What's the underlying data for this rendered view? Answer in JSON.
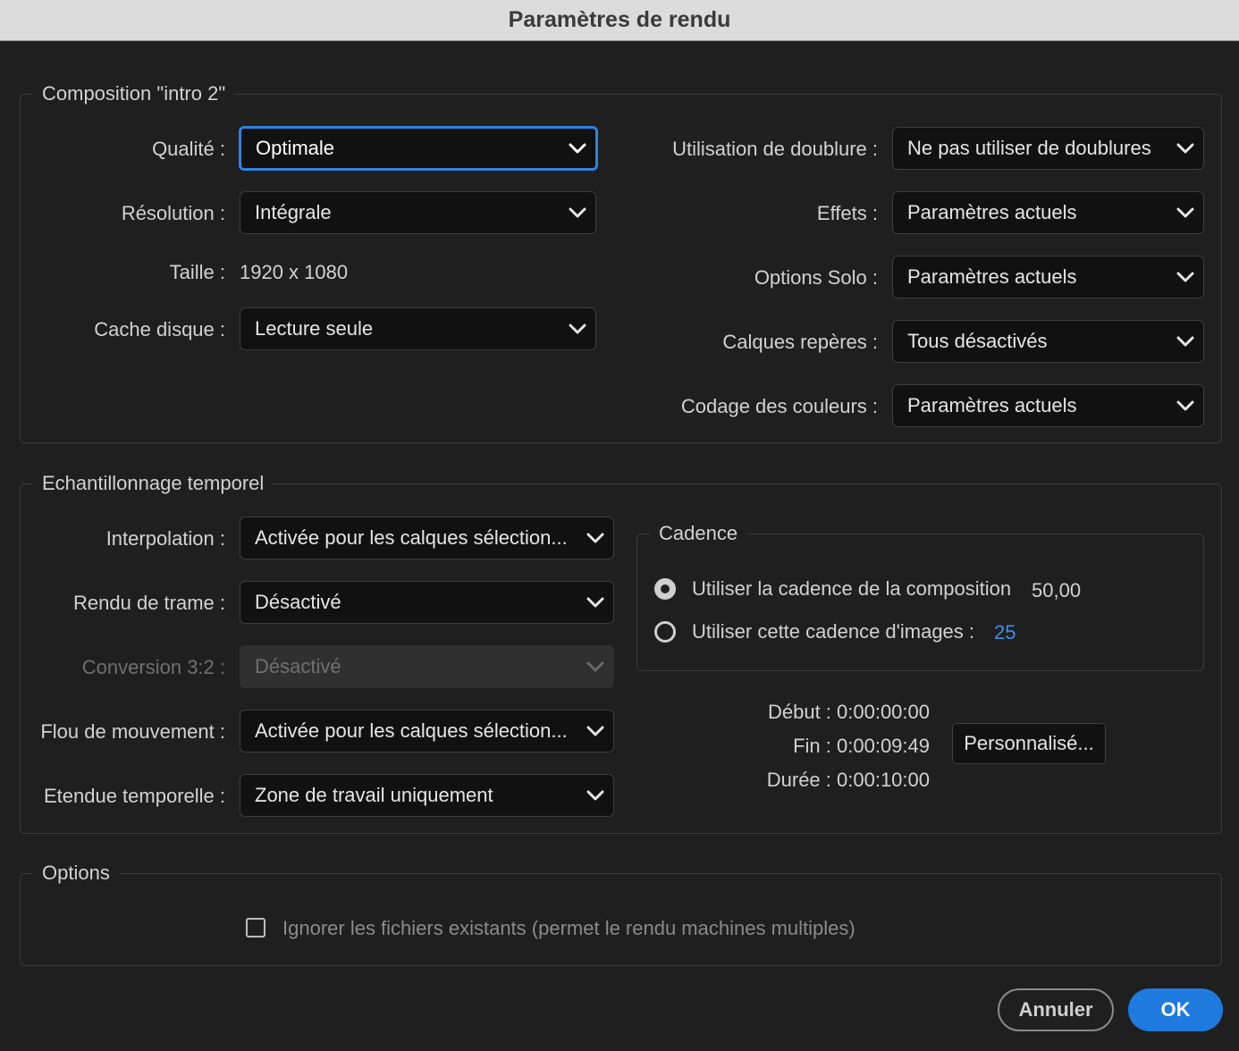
{
  "window": {
    "title": "Paramètres de rendu"
  },
  "composition": {
    "title": "Composition \"intro 2\"",
    "quality": {
      "label": "Qualité :",
      "value": "Optimale"
    },
    "resolution": {
      "label": "Résolution :",
      "value": "Intégrale"
    },
    "size": {
      "label": "Taille :",
      "value": "1920 x 1080"
    },
    "disk_cache": {
      "label": "Cache disque :",
      "value": "Lecture seule"
    },
    "proxy": {
      "label": "Utilisation de doublure :",
      "value": "Ne pas utiliser de doublures"
    },
    "effects": {
      "label": "Effets :",
      "value": "Paramètres actuels"
    },
    "solo": {
      "label": "Options Solo :",
      "value": "Paramètres actuels"
    },
    "guide_layers": {
      "label": "Calques repères :",
      "value": "Tous désactivés"
    },
    "color_depth": {
      "label": "Codage des couleurs :",
      "value": "Paramètres actuels"
    }
  },
  "time_sampling": {
    "title": "Echantillonnage temporel",
    "frame_blending": {
      "label": "Interpolation :",
      "value": "Activée pour les calques sélection..."
    },
    "field_render": {
      "label": "Rendu de trame :",
      "value": "Désactivé"
    },
    "pulldown": {
      "label": "Conversion 3:2 :",
      "value": "Désactivé"
    },
    "motion_blur": {
      "label": "Flou de mouvement :",
      "value": "Activée pour les calques sélection..."
    },
    "time_span": {
      "label": "Etendue temporelle :",
      "value": "Zone de travail uniquement"
    },
    "frame_rate": {
      "title": "Cadence",
      "use_comp_label": "Utiliser la cadence de la composition",
      "use_comp_value": "50,00",
      "use_this_label": "Utiliser cette cadence d'images :",
      "use_this_value": "25",
      "selected": "composition"
    },
    "start": "Début : 0:00:00:00",
    "end": "Fin : 0:00:09:49",
    "duration": "Durée : 0:00:10:00",
    "custom_button": "Personnalisé..."
  },
  "options": {
    "title": "Options",
    "skip_existing_label": "Ignorer les fichiers existants (permet le rendu machines multiples)",
    "skip_existing_checked": false
  },
  "buttons": {
    "cancel": "Annuler",
    "ok": "OK"
  },
  "colors": {
    "accent": "#1f7ae0",
    "focus_border": "#2f83e0",
    "link_value": "#3d8fe8",
    "background": "#1f1f1f"
  }
}
